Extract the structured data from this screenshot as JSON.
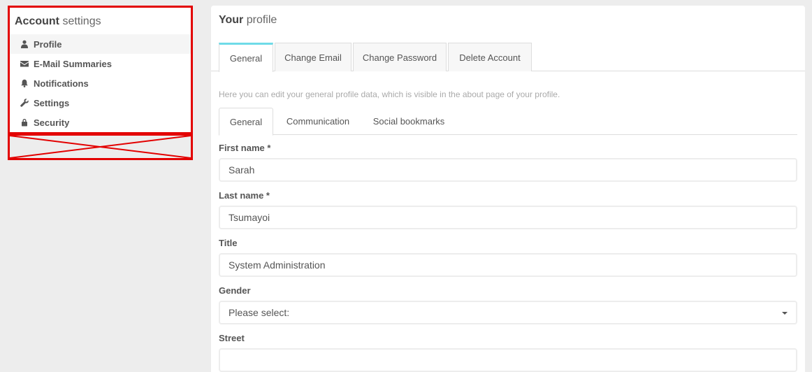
{
  "sidebar": {
    "title_bold": "Account",
    "title_light": "settings",
    "items": [
      {
        "label": "Profile",
        "icon": "user-icon"
      },
      {
        "label": "E-Mail Summaries",
        "icon": "envelope-icon"
      },
      {
        "label": "Notifications",
        "icon": "bell-icon"
      },
      {
        "label": "Settings",
        "icon": "wrench-icon"
      },
      {
        "label": "Security",
        "icon": "lock-icon"
      }
    ]
  },
  "panel": {
    "title_bold": "Your",
    "title_light": "profile",
    "tabs": [
      "General",
      "Change Email",
      "Change Password",
      "Delete Account"
    ],
    "intro": "Here you can edit your general profile data, which is visible in the about page of your profile.",
    "subtabs": [
      "General",
      "Communication",
      "Social bookmarks"
    ]
  },
  "form": {
    "first_name": {
      "label": "First name *",
      "value": "Sarah"
    },
    "last_name": {
      "label": "Last name *",
      "value": "Tsumayoi"
    },
    "title": {
      "label": "Title",
      "value": "System Administration"
    },
    "gender": {
      "label": "Gender",
      "value": "Please select:"
    },
    "street": {
      "label": "Street",
      "value": ""
    }
  },
  "colors": {
    "active_tab_accent": "#6fdbe8",
    "highlight_border": "#e30000",
    "page_background": "#ededed"
  }
}
